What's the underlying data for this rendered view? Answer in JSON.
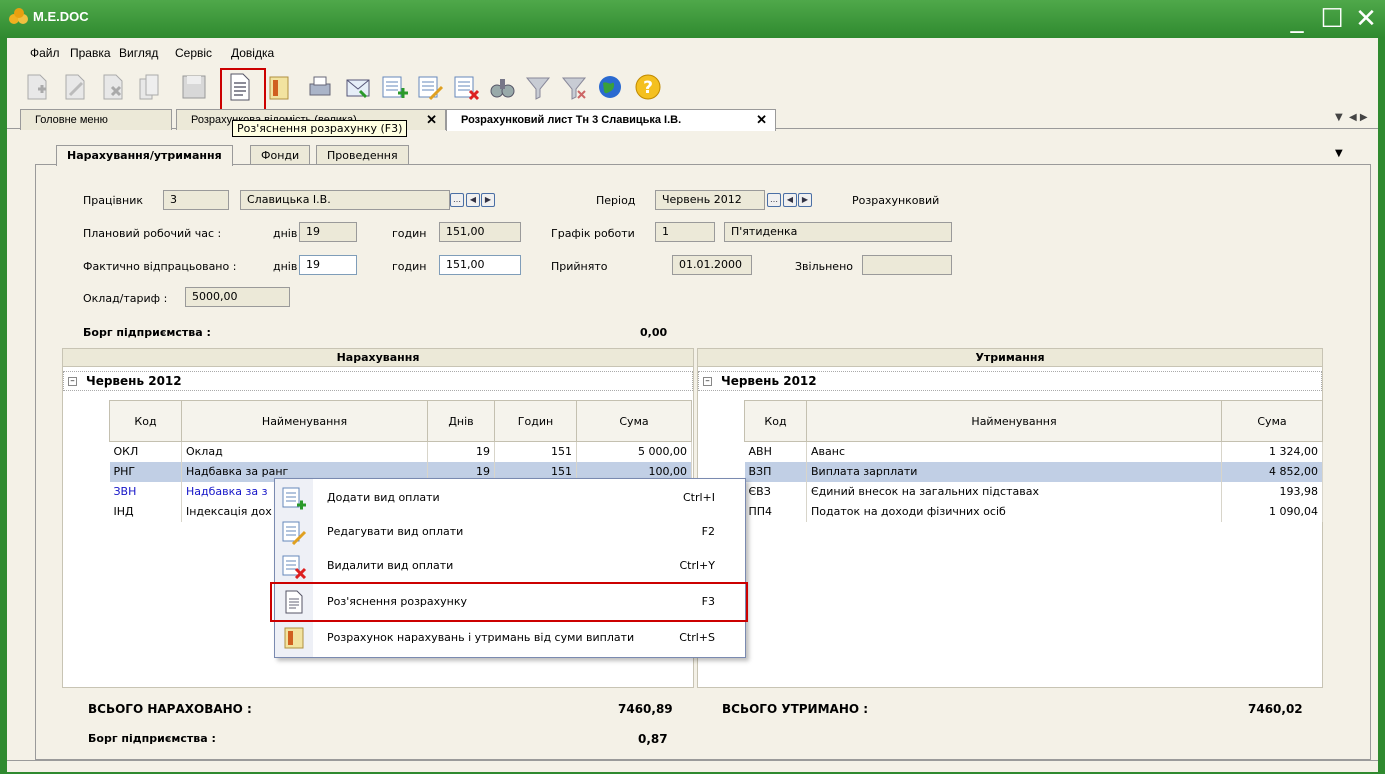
{
  "window": {
    "title": "M.E.DOC",
    "minimize": "_",
    "maximize": "☐",
    "close": "✕"
  },
  "menu": [
    "Файл",
    "Правка",
    "Вигляд",
    "Сервіс",
    "Довідка"
  ],
  "toolbar": {
    "icons": [
      "add-doc-icon",
      "edit-doc-icon",
      "delete-doc-icon",
      "copy-doc-icon",
      "save-icon",
      "explanation-icon",
      "report-icon",
      "print-icon",
      "mail-icon",
      "add-row-icon",
      "edit-row-icon",
      "delete-row-icon",
      "binoculars-icon",
      "filter-icon",
      "clear-filter-icon",
      "globe-icon",
      "help-icon"
    ],
    "highlighted": "explanation-icon",
    "tooltip": "Роз'яснення розрахунку (F3)"
  },
  "tabs": [
    {
      "label": "Головне меню"
    },
    {
      "label": "Розрахункова відомість (велика)"
    },
    {
      "label": "Розрахунковий лист Тн 3 Славицька І.В."
    }
  ],
  "subtabs": [
    "Нарахування/утримання",
    "Фонди",
    "Проведення"
  ],
  "form": {
    "employee_label": "Працівник",
    "employee_id": "3",
    "employee_name": "Славицька І.В.",
    "period_label": "Період",
    "period_value": "Червень 2012",
    "period_type": "Розрахунковий",
    "planned_label": "Плановий робочий час :",
    "days_label": "днів",
    "hours_label": "годин",
    "planned_days": "19",
    "planned_hours": "151,00",
    "schedule_label": "Графік роботи",
    "schedule_id": "1",
    "schedule_name": "П'ятиденка",
    "worked_label": "Фактично відпрацьовано :",
    "worked_days": "19",
    "worked_hours": "151,00",
    "hired_label": "Прийнято",
    "hired_date": "01.01.2000",
    "fired_label": "Звільнено",
    "fired_date": "",
    "salary_label": "Оклад/тариф :",
    "salary_value": "5000,00",
    "debt_label": "Борг підприємства :",
    "debt_value": "0,00"
  },
  "accruals": {
    "title": "Нарахування",
    "group": "Червень 2012",
    "columns": [
      "Код",
      "Найменування",
      "Днів",
      "Годин",
      "Сума"
    ],
    "rows": [
      {
        "code": "ОКЛ",
        "name": "Оклад",
        "days": "19",
        "hours": "151",
        "sum": "5 000,00"
      },
      {
        "code": "РНГ",
        "name": "Надбавка за ранг",
        "days": "19",
        "hours": "151",
        "sum": "100,00"
      },
      {
        "code": "ЗВН",
        "name": "Надбавка за з",
        "days": "",
        "hours": "",
        "sum": ""
      },
      {
        "code": "ІНД",
        "name": "Індексація дох",
        "days": "",
        "hours": "",
        "sum": ""
      }
    ],
    "total_label": "ВСЬОГО НАРАХОВАНО :",
    "total_value": "7460,89",
    "debt_label": "Борг підприємства :",
    "debt_value": "0,87"
  },
  "deductions": {
    "title": "Утримання",
    "group": "Червень 2012",
    "columns": [
      "Код",
      "Найменування",
      "Сума"
    ],
    "rows": [
      {
        "code": "АВН",
        "name": "Аванс",
        "sum": "1 324,00"
      },
      {
        "code": "ВЗП",
        "name": "Виплата зарплати",
        "sum": "4 852,00"
      },
      {
        "code": "ЄВЗ",
        "name": "Єдиний внесок на загальних підставах",
        "sum": "193,98"
      },
      {
        "code": "ПП4",
        "name": "Податок на доходи фізичних осіб",
        "sum": "1 090,04"
      }
    ],
    "total_label": "ВСЬОГО УТРИМАНО :",
    "total_value": "7460,02"
  },
  "context_menu": [
    {
      "label": "Додати вид оплати",
      "key": "Ctrl+I",
      "icon": "add-row-icon"
    },
    {
      "label": "Редагувати вид оплати",
      "key": "F2",
      "icon": "edit-row-icon"
    },
    {
      "label": "Видалити вид оплати",
      "key": "Ctrl+Y",
      "icon": "delete-row-icon"
    },
    {
      "label": "Роз'яснення розрахунку",
      "key": "F3",
      "icon": "explanation-icon"
    },
    {
      "label": "Розрахунок нарахувань і утримань від суми виплати",
      "key": "Ctrl+S",
      "icon": "calc-icon"
    }
  ],
  "colors": {
    "titlebar": "#3a9a3a",
    "highlight": "#cc0000",
    "selected_row": "#c1cfe5"
  }
}
